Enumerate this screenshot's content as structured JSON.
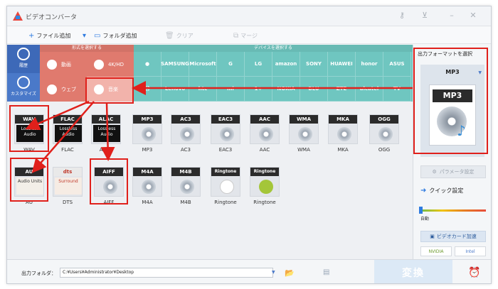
{
  "window": {
    "title": "ビデオコンバータ"
  },
  "toolbar": {
    "add_file": "ファイル追加",
    "add_folder": "フォルダ追加",
    "clear": "クリア",
    "merge": "マージ"
  },
  "leftnav": {
    "history": "履歴",
    "customize": "カスタマイズ"
  },
  "format_group": {
    "header": "形式を選択する",
    "items": [
      {
        "label": "動画"
      },
      {
        "label": "4K/HD"
      },
      {
        "label": "ウェブ"
      },
      {
        "label": "音楽"
      }
    ]
  },
  "device_group": {
    "header": "デバイスを選択する",
    "brands": [
      "",
      "SAMSUNG",
      "Microsoft",
      "G",
      "LG",
      "amazon",
      "SONY",
      "HUAWEI",
      "honor",
      "ASUS",
      "",
      "Lenovo",
      "htc",
      "mi",
      "1+",
      "NOKIA",
      "BLU",
      "ZTE",
      "alcatel",
      "TV"
    ]
  },
  "formats": {
    "row1": [
      {
        "tag": "WAV",
        "sub": "Lossless Audio",
        "caption": "WAV"
      },
      {
        "tag": "FLAC",
        "sub": "Lossless Audio",
        "caption": "FLAC"
      },
      {
        "tag": "ALAC",
        "sub": "Lossless Audio",
        "caption": "ALAC"
      },
      {
        "tag": "MP3",
        "sub": "",
        "caption": "MP3"
      },
      {
        "tag": "AC3",
        "sub": "",
        "caption": "AC3"
      },
      {
        "tag": "EAC3",
        "sub": "",
        "caption": "EAC3"
      },
      {
        "tag": "AAC",
        "sub": "",
        "caption": "AAC"
      },
      {
        "tag": "WMA",
        "sub": "",
        "caption": "WMA"
      },
      {
        "tag": "MKA",
        "sub": "",
        "caption": "MKA"
      },
      {
        "tag": "OGG",
        "sub": "",
        "caption": "OGG"
      }
    ],
    "row2": [
      {
        "tag": "AU",
        "sub": "Audio Units",
        "caption": "AU"
      },
      {
        "tag": "dts",
        "sub": "Surround",
        "caption": "DTS"
      },
      {
        "tag": "AIFF",
        "sub": "",
        "caption": "AIFF"
      },
      {
        "tag": "M4A",
        "sub": "",
        "caption": "M4A"
      },
      {
        "tag": "M4B",
        "sub": "",
        "caption": "M4B"
      },
      {
        "tag": "Ringtone",
        "sub": "",
        "caption": "Ringtone"
      },
      {
        "tag": "Ringtone",
        "sub": "",
        "caption": "Ringtone"
      }
    ]
  },
  "rightpanel": {
    "title": "出力フォーマットを選択",
    "selected_format": "MP3",
    "preview_label": "MP3",
    "param_button": "パラメータ設定",
    "quick_setting": "クイック設定",
    "slider_label": "自動",
    "gpu_button": "ビデオカード加速",
    "chips": [
      "NVIDIA",
      "Intel"
    ]
  },
  "bottombar": {
    "output_folder_label": "出力フォルダ：",
    "output_path": "C:¥Users¥Administrator¥Desktop",
    "convert_button": "変換"
  }
}
